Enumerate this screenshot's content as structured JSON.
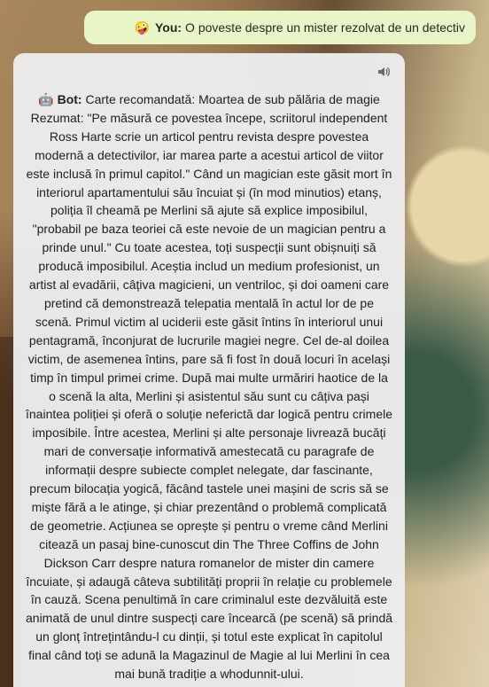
{
  "user": {
    "emoji": "🤪",
    "label": "You:",
    "message": "O poveste despre un mister rezolvat de un detectiv"
  },
  "bot": {
    "emoji": "🤖",
    "label": "Bot:",
    "message": "Carte recomandată: Moartea de sub pălăria de magie Rezumat: \"Pe măsură ce povestea începe, scriitorul independent Ross Harte scrie un articol pentru revista despre povestea modernă a detectivilor, iar marea parte a acestui articol de viitor este inclusă în primul capitol.\" Când un magician este găsit mort în interiorul apartamentului său încuiat și (în mod minutios) etanș, poliția îl cheamă pe Merlini să ajute să explice imposibilul, \"probabil pe baza teoriei că este nevoie de un magician pentru a prinde unul.\" Cu toate acestea, toți suspecții sunt obișnuiți să producă imposibilul. Aceștia includ un medium profesionist, un artist al evadării, câțiva magicieni, un ventriloc, și doi oameni care pretind că demonstrează telepatia mentală în actul lor de pe scenă. Primul victim al uciderii este găsit întins în interiorul unui pentagramă, înconjurat de lucrurile magiei negre. Cel de-al doilea victim, de asemenea întins, pare să fi fost în două locuri în același timp în timpul primei crime. După mai multe urmăriri haotice de la o scenă la alta, Merlini și asistentul său sunt cu câțiva pași înaintea poliției și oferă o soluție neferictă dar logică pentru crimele imposibile. Între acestea, Merlini și alte personaje livrează bucăți mari de conversație informativă amestecată cu paragrafe de informații despre subiecte complet nelegate, dar fascinante, precum bilocația yogică, făcând tastele unei mașini de scris să se miște fără a le atinge, și chiar prezentând o problemă complicată de geometrie. Acțiunea se oprește și pentru o vreme când Merlini citează un pasaj bine-cunoscut din The Three Coffins de John Dickson Carr despre natura romanelor de mister din camere încuiate, și adaugă câteva subtilități proprii în relație cu problemele în cauză. Scena penultimă în care criminalul este dezvăluită este animată de unul dintre suspecți care încearcă (pe scenă) să prindă un glonț întrețintându-l cu dinții, și totul este explicat în capitolul final când toți se adună la Magazinul de Magie al lui Merlini în cea mai bună tradiție a whodunnit-ului."
  },
  "icons": {
    "speaker": "speaker-icon"
  }
}
